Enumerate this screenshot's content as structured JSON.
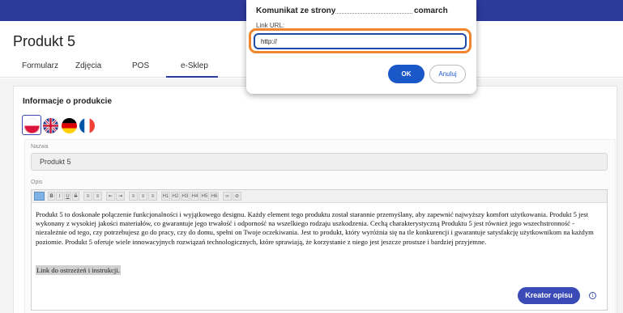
{
  "page": {
    "title": "Produkt 5"
  },
  "tabs": [
    "Formularz",
    "Zdjęcia",
    "POS",
    "e-Sklep"
  ],
  "active_tab": "e-Sklep",
  "section": {
    "title": "Informacje o produkcie"
  },
  "languages": [
    "pl",
    "en",
    "de",
    "fr"
  ],
  "fields": {
    "name_label": "Nazwa",
    "name_value": "Produkt 5",
    "desc_label": "Opis"
  },
  "toolbar": {
    "buttons": [
      "B",
      "I",
      "U",
      "S",
      "H1",
      "H2",
      "H3",
      "H4",
      "H5",
      "H6"
    ]
  },
  "editor": {
    "paragraph": "Produkt 5 to doskonałe połączenie funkcjonalności i wyjątkowego designu. Każdy element tego produktu został starannie przemyślany, aby zapewnić najwyższy komfort użytkowania. Produkt 5 jest wykonany z wysokiej jakości materiałów, co gwarantuje jego trwałość i odporność na wszelkiego rodzaju uszkodzenia. Cechą charakterystyczną Produktu 5 jest również jego wszechstronność - niezależnie od tego, czy potrzebujesz go do pracy, czy do domu, spełni on Twoje oczekiwania. Jest to produkt, który wyróżnia się na tle konkurencji i gwarantuje satysfakcję użytkownikom na każdym poziomie. Produkt 5 oferuje wiele innowacyjnych rozwiązań technologicznych, które sprawiają, że korzystanie z niego jest jeszcze prostsze i bardziej przyjemne.",
    "selected_text": "Link do ostrzeżeń i instrukcji."
  },
  "kreator_button": "Kreator opisu",
  "dialog": {
    "title": "Komunikat ze strony",
    "domain": "comarch",
    "label": "Link URL:",
    "input_value": "http://",
    "ok": "OK",
    "cancel": "Anuluj"
  },
  "colors": {
    "brand": "#2d3a9c",
    "ok_button": "#1a57c7",
    "highlight_outline": "#f0852d"
  }
}
